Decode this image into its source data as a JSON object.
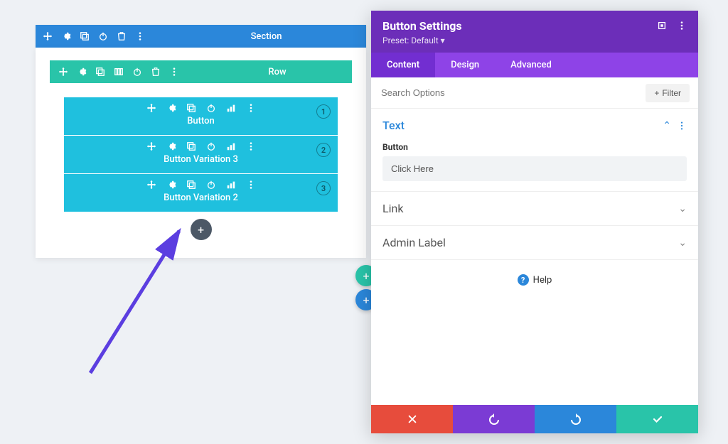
{
  "section": {
    "label": "Section"
  },
  "row": {
    "label": "Row"
  },
  "modules": [
    {
      "label": "Button",
      "num": "1"
    },
    {
      "label": "Button Variation 3",
      "num": "2"
    },
    {
      "label": "Button Variation 2",
      "num": "3"
    }
  ],
  "panel": {
    "title": "Button Settings",
    "preset": "Preset: Default",
    "tabs": {
      "content": "Content",
      "design": "Design",
      "advanced": "Advanced"
    },
    "search_placeholder": "Search Options",
    "filter": "Filter",
    "sections": {
      "text": "Text",
      "link": "Link",
      "admin": "Admin Label"
    },
    "button_field_label": "Button",
    "button_field_value": "Click Here",
    "help": "Help"
  }
}
